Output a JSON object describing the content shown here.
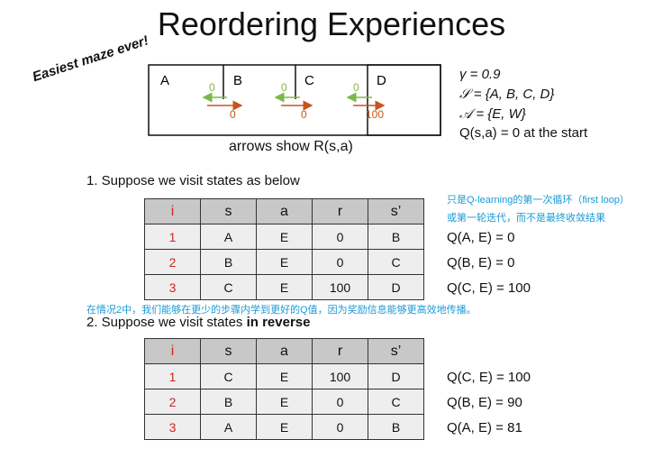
{
  "title": "Reordering Experiences",
  "slogan": "Easiest maze ever!",
  "maze": {
    "states": [
      "A",
      "B",
      "C",
      "D"
    ],
    "left_arrow_values": [
      "0",
      "0",
      "0"
    ],
    "right_arrow_values": [
      "0",
      "0",
      "100"
    ],
    "caption": "arrows show R(s,a)",
    "colors": {
      "left_arrow": "#7db84a",
      "right_arrow": "#c8541d"
    }
  },
  "params": {
    "gamma": "γ = 0.9",
    "states": "𝒮 = {A, B, C, D}",
    "actions": "𝒜 = {E, W}",
    "init": "Q(s,a) = 0 at the start"
  },
  "section1": {
    "heading": "1. Suppose we visit states as below",
    "note_line1": "只是Q-learning的第一次循环（first loop）",
    "note_line2": "或第一轮迭代，而不是最终收敛结果",
    "headers": [
      "i",
      "s",
      "a",
      "r",
      "s’"
    ],
    "rows": [
      [
        "1",
        "A",
        "E",
        "0",
        "B"
      ],
      [
        "2",
        "B",
        "E",
        "0",
        "C"
      ],
      [
        "3",
        "C",
        "E",
        "100",
        "D"
      ]
    ],
    "q_values": [
      "Q(A, E) = 0",
      "Q(B, E) = 0",
      "Q(C, E) = 100"
    ]
  },
  "note_mid": "在情况2中，我们能够在更少的步骤内学到更好的Q值，因为奖励信息能够更高效地传播。",
  "section2": {
    "heading_prefix": "2. Suppose we visit states ",
    "heading_bold": "in reverse",
    "headers": [
      "i",
      "s",
      "a",
      "r",
      "s’"
    ],
    "rows": [
      [
        "1",
        "C",
        "E",
        "100",
        "D"
      ],
      [
        "2",
        "B",
        "E",
        "0",
        "C"
      ],
      [
        "3",
        "A",
        "E",
        "0",
        "B"
      ]
    ],
    "q_values": [
      "Q(C, E) = 100",
      "Q(B, E) = 90",
      "Q(A, E) = 81"
    ]
  }
}
